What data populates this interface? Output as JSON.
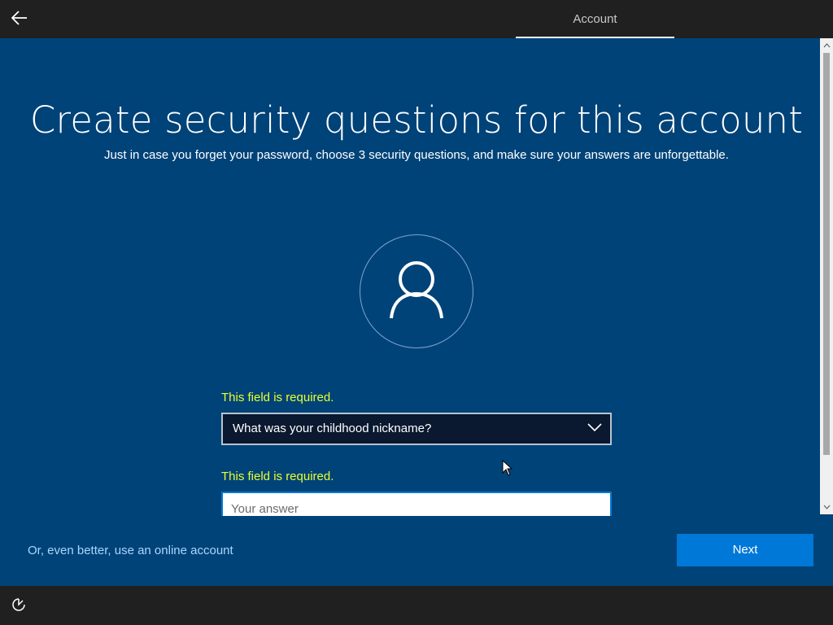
{
  "header": {
    "back_icon": "arrow-left-icon",
    "tab_label": "Account"
  },
  "main": {
    "title": "Create security questions for this account",
    "subtitle": "Just in case you forget your password, choose 3 security questions, and make sure your answers are unforgettable.",
    "avatar_icon": "user-icon",
    "question": {
      "error": "This field is required.",
      "selected": "What was your childhood nickname?"
    },
    "answer": {
      "error": "This field is required.",
      "value": "",
      "placeholder": "Your answer"
    }
  },
  "footer": {
    "online_account_link": "Or, even better, use an online account",
    "next_label": "Next"
  },
  "bottombar": {
    "ease_icon": "ease-of-access-icon"
  },
  "colors": {
    "background": "#004378",
    "accent": "#0078d7",
    "error": "#e8ff2f",
    "link": "#a9d7ff"
  }
}
